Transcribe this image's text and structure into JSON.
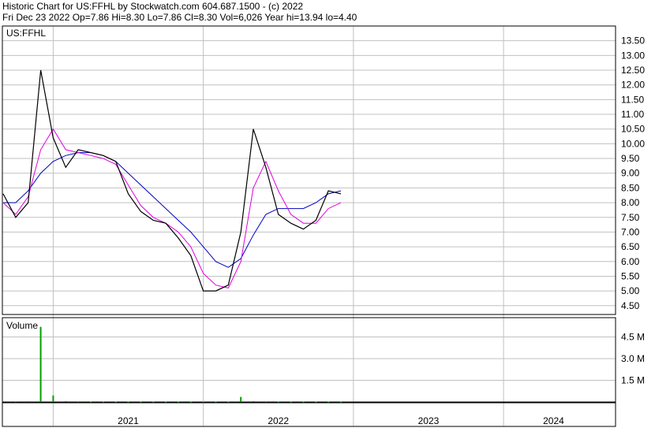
{
  "header": {
    "line1": "Historic Chart for US:FFHL by Stockwatch.com 604.687.1500 - (c) 2022",
    "line2": "Fri Dec 23 2022  Op=7.86  Hi=8.30  Lo=7.86  Cl=8.30  Vol=6,026  Year hi=13.94  lo=4.40"
  },
  "chart_data": [
    {
      "type": "line",
      "title": "US:FFHL",
      "y_ticks": [
        "13.50",
        "13.00",
        "12.50",
        "12.00",
        "11.50",
        "11.00",
        "10.50",
        "10.00",
        "9.50",
        "9.00",
        "8.50",
        "8.00",
        "7.50",
        "7.00",
        "6.50",
        "6.00",
        "5.50",
        "5.00",
        "4.50"
      ],
      "ylim": [
        4.2,
        14.0
      ],
      "x_ticks": [
        "2021",
        "2022",
        "2023",
        "2024"
      ],
      "x": [
        "2020-09",
        "2020-10",
        "2020-11",
        "2020-12",
        "2021-01",
        "2021-02",
        "2021-03",
        "2021-04",
        "2021-05",
        "2021-06",
        "2021-07",
        "2021-08",
        "2021-09",
        "2021-10",
        "2021-11",
        "2021-12",
        "2022-01",
        "2022-02",
        "2022-03",
        "2022-04",
        "2022-05",
        "2022-06",
        "2022-07",
        "2022-08",
        "2022-09",
        "2022-10",
        "2022-11",
        "2022-12"
      ],
      "series": [
        {
          "values": [
            8.3,
            7.5,
            8.0,
            12.5,
            10.2,
            9.2,
            9.8,
            9.7,
            9.6,
            9.4,
            8.3,
            7.7,
            7.4,
            7.3,
            6.8,
            6.2,
            5.0,
            5.0,
            5.2,
            7.0,
            10.5,
            9.2,
            7.6,
            7.3,
            7.1,
            7.4,
            8.4,
            8.3
          ]
        },
        {
          "values": [
            8.0,
            7.6,
            8.2,
            9.8,
            10.5,
            9.8,
            9.7,
            9.6,
            9.5,
            9.3,
            8.6,
            7.9,
            7.5,
            7.3,
            7.0,
            6.5,
            5.6,
            5.2,
            5.1,
            6.0,
            8.5,
            9.4,
            8.4,
            7.6,
            7.3,
            7.3,
            7.8,
            8.0
          ]
        },
        {
          "values": [
            8.0,
            8.0,
            8.4,
            9.0,
            9.4,
            9.6,
            9.7,
            9.7,
            9.6,
            9.4,
            9.0,
            8.6,
            8.2,
            7.8,
            7.4,
            7.0,
            6.5,
            6.0,
            5.8,
            6.1,
            6.9,
            7.6,
            7.8,
            7.8,
            7.8,
            8.0,
            8.3,
            8.4
          ]
        }
      ],
      "colors": {
        "price": "#000000",
        "ma_short": "#e000e0",
        "ma_long": "#0000c0",
        "volume": "#00a000",
        "grid": "#c0c0c0"
      }
    },
    {
      "type": "bar",
      "title": "Volume",
      "y_ticks": [
        "4.5 M",
        "3.0 M",
        "1.5 M"
      ],
      "ylim": [
        0,
        5400000
      ],
      "x": [
        "2020-09",
        "2020-10",
        "2020-11",
        "2020-12",
        "2021-01",
        "2021-02",
        "2021-03",
        "2021-04",
        "2021-05",
        "2021-06",
        "2021-07",
        "2021-08",
        "2021-09",
        "2021-10",
        "2021-11",
        "2021-12",
        "2022-01",
        "2022-02",
        "2022-03",
        "2022-04",
        "2022-05",
        "2022-06",
        "2022-07",
        "2022-08",
        "2022-09",
        "2022-10",
        "2022-11",
        "2022-12"
      ],
      "values": [
        60000,
        40000,
        50000,
        5200000,
        450000,
        60000,
        40000,
        30000,
        30000,
        25000,
        25000,
        20000,
        25000,
        20000,
        20000,
        20000,
        30000,
        25000,
        30000,
        350000,
        60000,
        40000,
        30000,
        20000,
        20000,
        20000,
        25000,
        20000
      ]
    }
  ]
}
